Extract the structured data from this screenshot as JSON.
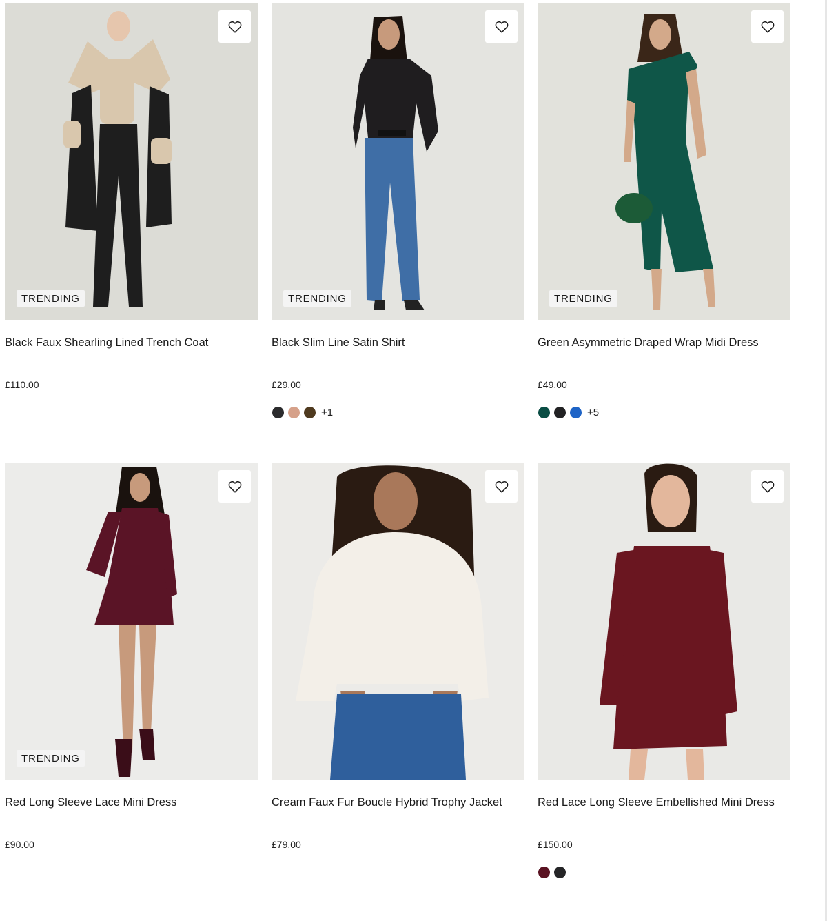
{
  "products": [
    {
      "name": "Black Faux Shearling Lined Trench Coat",
      "price": "£110.00",
      "badge": "TRENDING",
      "image": {
        "bg": "#dcdcd6",
        "main": "#1e1e1e",
        "accent": "#d9c7ad",
        "skin": "#e6c6ad"
      },
      "swatches": [],
      "more": ""
    },
    {
      "name": "Black Slim Line Satin Shirt",
      "price": "£29.00",
      "badge": "TRENDING",
      "image": {
        "bg": "#e4e4e0",
        "main": "#1f1d1f",
        "accent": "#3f6ea6",
        "skin": "#c79a7c"
      },
      "swatches": [
        "#2b2b2d",
        "#d6a18a",
        "#4f3a1f"
      ],
      "more": "+1"
    },
    {
      "name": "Green Asymmetric Draped Wrap Midi Dress",
      "price": "£49.00",
      "badge": "TRENDING",
      "image": {
        "bg": "#e2e2dc",
        "main": "#0f5648",
        "accent": "#1c5b37",
        "skin": "#d3a98a"
      },
      "swatches": [
        "#0a4d44",
        "#222224",
        "#1e64c6"
      ],
      "more": "+5"
    },
    {
      "name": "Red Long Sleeve Lace Mini Dress",
      "price": "£90.00",
      "badge": "TRENDING",
      "image": {
        "bg": "#ececea",
        "main": "#5a1426",
        "accent": "#3a0d18",
        "skin": "#c79a7c"
      },
      "swatches": [],
      "more": ""
    },
    {
      "name": "Cream Faux Fur Boucle Hybrid Trophy Jacket",
      "price": "£79.00",
      "badge": "",
      "image": {
        "bg": "#ecebe8",
        "main": "#f3efe8",
        "accent": "#2f5f9c",
        "skin": "#a9785a"
      },
      "swatches": [],
      "more": ""
    },
    {
      "name": "Red Lace Long Sleeve Embellished Mini Dress",
      "price": "£150.00",
      "badge": "",
      "image": {
        "bg": "#e9e9e6",
        "main": "#6a1620",
        "accent": "#4a0e17",
        "skin": "#e3b79c"
      },
      "swatches": [
        "#5a1322",
        "#252527"
      ],
      "more": ""
    }
  ]
}
